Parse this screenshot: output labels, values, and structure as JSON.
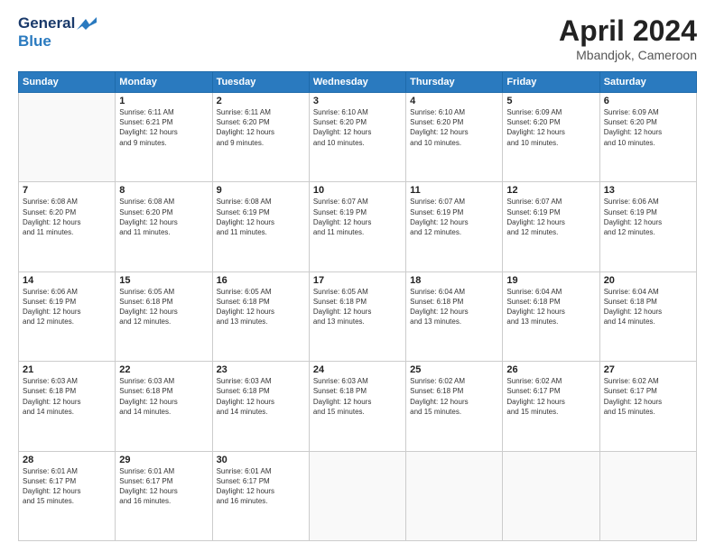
{
  "header": {
    "logo_line1": "General",
    "logo_line2": "Blue",
    "main_title": "April 2024",
    "subtitle": "Mbandjok, Cameroon"
  },
  "calendar": {
    "weekdays": [
      "Sunday",
      "Monday",
      "Tuesday",
      "Wednesday",
      "Thursday",
      "Friday",
      "Saturday"
    ],
    "weeks": [
      [
        {
          "day": "",
          "info": ""
        },
        {
          "day": "1",
          "info": "Sunrise: 6:11 AM\nSunset: 6:21 PM\nDaylight: 12 hours\nand 9 minutes."
        },
        {
          "day": "2",
          "info": "Sunrise: 6:11 AM\nSunset: 6:20 PM\nDaylight: 12 hours\nand 9 minutes."
        },
        {
          "day": "3",
          "info": "Sunrise: 6:10 AM\nSunset: 6:20 PM\nDaylight: 12 hours\nand 10 minutes."
        },
        {
          "day": "4",
          "info": "Sunrise: 6:10 AM\nSunset: 6:20 PM\nDaylight: 12 hours\nand 10 minutes."
        },
        {
          "day": "5",
          "info": "Sunrise: 6:09 AM\nSunset: 6:20 PM\nDaylight: 12 hours\nand 10 minutes."
        },
        {
          "day": "6",
          "info": "Sunrise: 6:09 AM\nSunset: 6:20 PM\nDaylight: 12 hours\nand 10 minutes."
        }
      ],
      [
        {
          "day": "7",
          "info": "Sunrise: 6:08 AM\nSunset: 6:20 PM\nDaylight: 12 hours\nand 11 minutes."
        },
        {
          "day": "8",
          "info": "Sunrise: 6:08 AM\nSunset: 6:20 PM\nDaylight: 12 hours\nand 11 minutes."
        },
        {
          "day": "9",
          "info": "Sunrise: 6:08 AM\nSunset: 6:19 PM\nDaylight: 12 hours\nand 11 minutes."
        },
        {
          "day": "10",
          "info": "Sunrise: 6:07 AM\nSunset: 6:19 PM\nDaylight: 12 hours\nand 11 minutes."
        },
        {
          "day": "11",
          "info": "Sunrise: 6:07 AM\nSunset: 6:19 PM\nDaylight: 12 hours\nand 12 minutes."
        },
        {
          "day": "12",
          "info": "Sunrise: 6:07 AM\nSunset: 6:19 PM\nDaylight: 12 hours\nand 12 minutes."
        },
        {
          "day": "13",
          "info": "Sunrise: 6:06 AM\nSunset: 6:19 PM\nDaylight: 12 hours\nand 12 minutes."
        }
      ],
      [
        {
          "day": "14",
          "info": "Sunrise: 6:06 AM\nSunset: 6:19 PM\nDaylight: 12 hours\nand 12 minutes."
        },
        {
          "day": "15",
          "info": "Sunrise: 6:05 AM\nSunset: 6:18 PM\nDaylight: 12 hours\nand 12 minutes."
        },
        {
          "day": "16",
          "info": "Sunrise: 6:05 AM\nSunset: 6:18 PM\nDaylight: 12 hours\nand 13 minutes."
        },
        {
          "day": "17",
          "info": "Sunrise: 6:05 AM\nSunset: 6:18 PM\nDaylight: 12 hours\nand 13 minutes."
        },
        {
          "day": "18",
          "info": "Sunrise: 6:04 AM\nSunset: 6:18 PM\nDaylight: 12 hours\nand 13 minutes."
        },
        {
          "day": "19",
          "info": "Sunrise: 6:04 AM\nSunset: 6:18 PM\nDaylight: 12 hours\nand 13 minutes."
        },
        {
          "day": "20",
          "info": "Sunrise: 6:04 AM\nSunset: 6:18 PM\nDaylight: 12 hours\nand 14 minutes."
        }
      ],
      [
        {
          "day": "21",
          "info": "Sunrise: 6:03 AM\nSunset: 6:18 PM\nDaylight: 12 hours\nand 14 minutes."
        },
        {
          "day": "22",
          "info": "Sunrise: 6:03 AM\nSunset: 6:18 PM\nDaylight: 12 hours\nand 14 minutes."
        },
        {
          "day": "23",
          "info": "Sunrise: 6:03 AM\nSunset: 6:18 PM\nDaylight: 12 hours\nand 14 minutes."
        },
        {
          "day": "24",
          "info": "Sunrise: 6:03 AM\nSunset: 6:18 PM\nDaylight: 12 hours\nand 15 minutes."
        },
        {
          "day": "25",
          "info": "Sunrise: 6:02 AM\nSunset: 6:18 PM\nDaylight: 12 hours\nand 15 minutes."
        },
        {
          "day": "26",
          "info": "Sunrise: 6:02 AM\nSunset: 6:17 PM\nDaylight: 12 hours\nand 15 minutes."
        },
        {
          "day": "27",
          "info": "Sunrise: 6:02 AM\nSunset: 6:17 PM\nDaylight: 12 hours\nand 15 minutes."
        }
      ],
      [
        {
          "day": "28",
          "info": "Sunrise: 6:01 AM\nSunset: 6:17 PM\nDaylight: 12 hours\nand 15 minutes."
        },
        {
          "day": "29",
          "info": "Sunrise: 6:01 AM\nSunset: 6:17 PM\nDaylight: 12 hours\nand 16 minutes."
        },
        {
          "day": "30",
          "info": "Sunrise: 6:01 AM\nSunset: 6:17 PM\nDaylight: 12 hours\nand 16 minutes."
        },
        {
          "day": "",
          "info": ""
        },
        {
          "day": "",
          "info": ""
        },
        {
          "day": "",
          "info": ""
        },
        {
          "day": "",
          "info": ""
        }
      ]
    ]
  }
}
